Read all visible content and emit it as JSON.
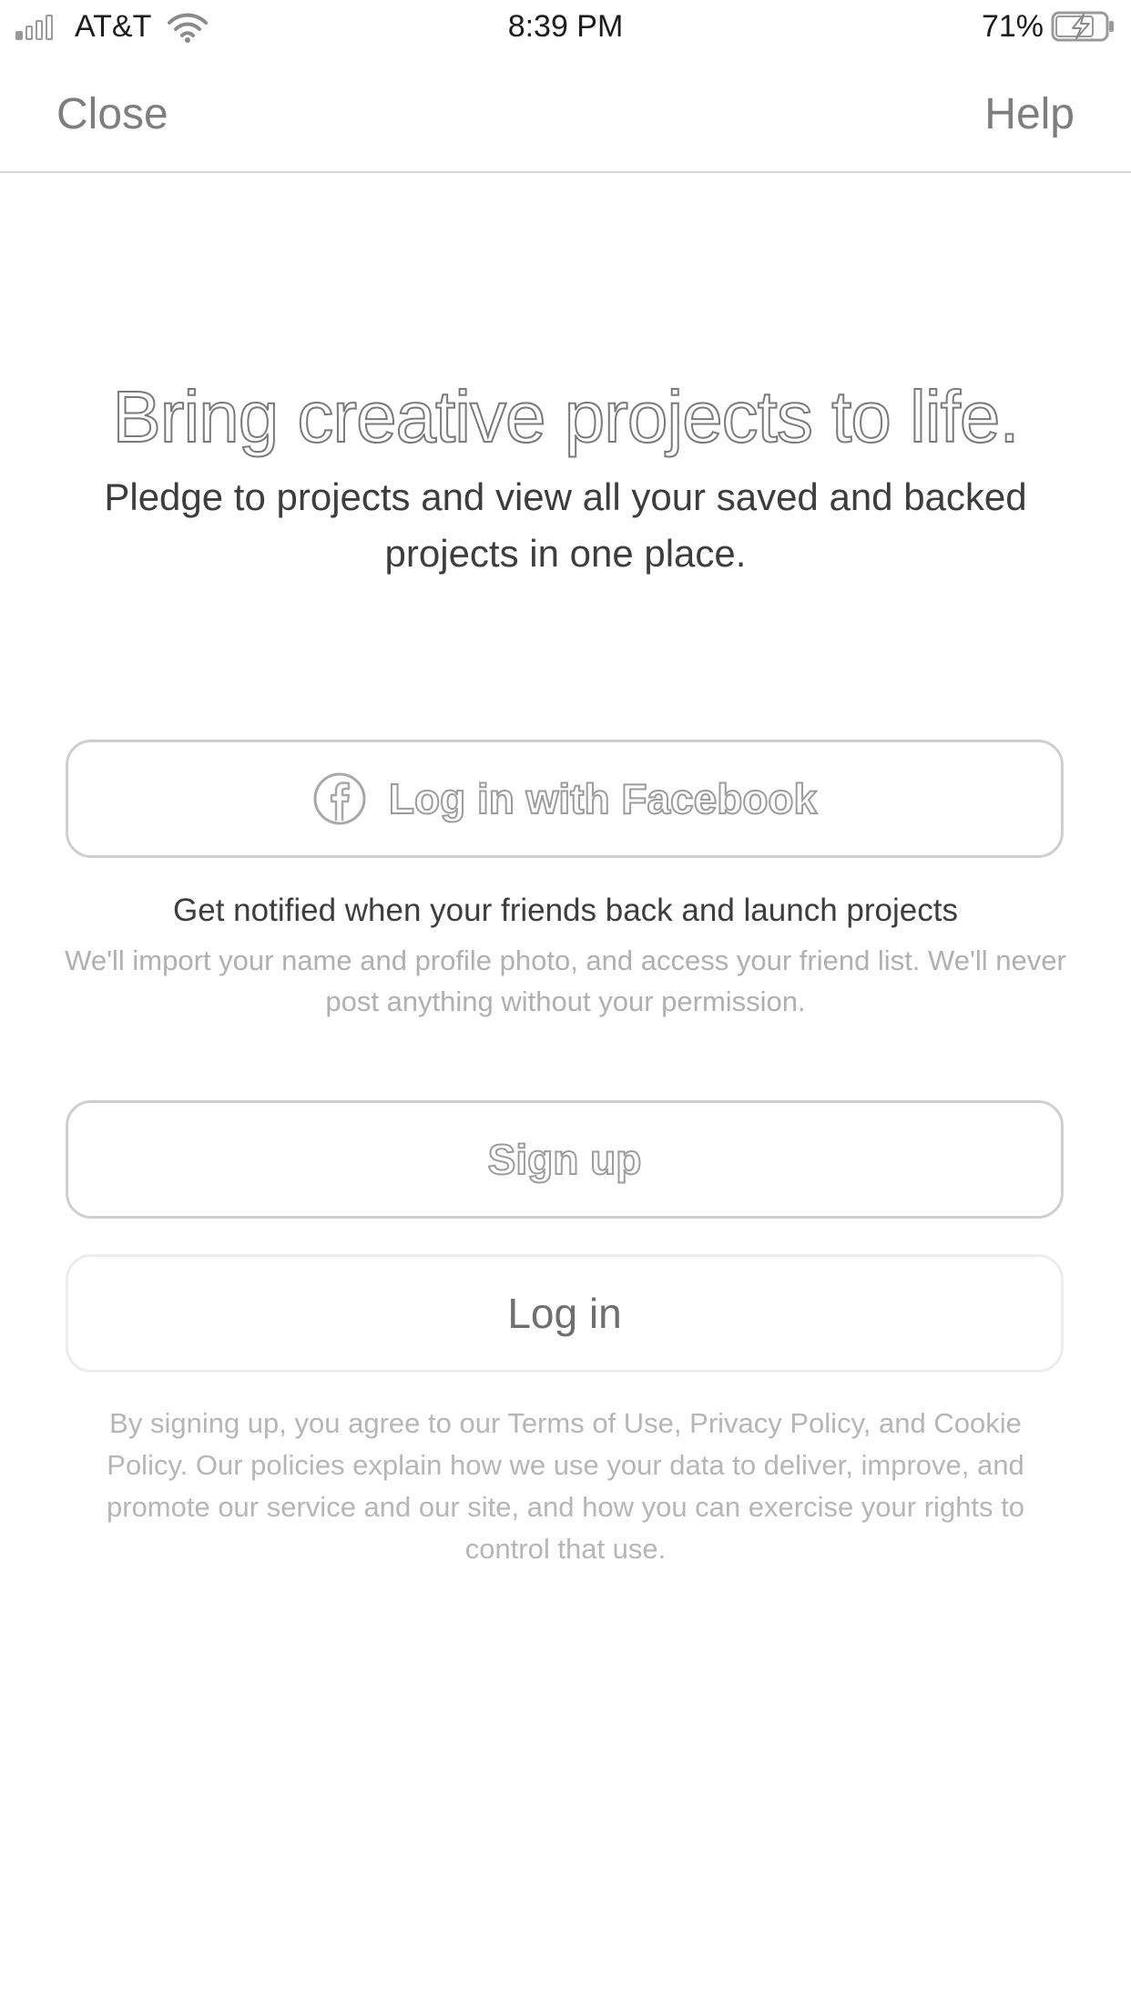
{
  "status_bar": {
    "carrier": "AT&T",
    "time": "8:39 PM",
    "battery_percent": "71%",
    "signal_icon": "cellular-signal-icon",
    "wifi_icon": "wifi-icon",
    "battery_icon": "battery-charging-icon"
  },
  "nav": {
    "close_label": "Close",
    "help_label": "Help"
  },
  "hero": {
    "title": "Bring creative projects to life.",
    "subtitle": "Pledge to projects and view all your saved and backed projects in one place."
  },
  "facebook": {
    "button_label": "Log in with Facebook",
    "icon": "facebook-icon",
    "note_title": "Get notified when your friends back and launch projects",
    "note_body": "We'll import your name and profile photo, and access your friend list. We'll never post anything without your permission."
  },
  "actions": {
    "signup_label": "Sign up",
    "login_label": "Log in"
  },
  "legal": {
    "text": "By signing up, you agree to our Terms of Use, Privacy Policy, and Cookie Policy. Our policies explain how we use your data to deliver, improve, and promote our service and our site, and how you can exercise your rights to control that use."
  }
}
